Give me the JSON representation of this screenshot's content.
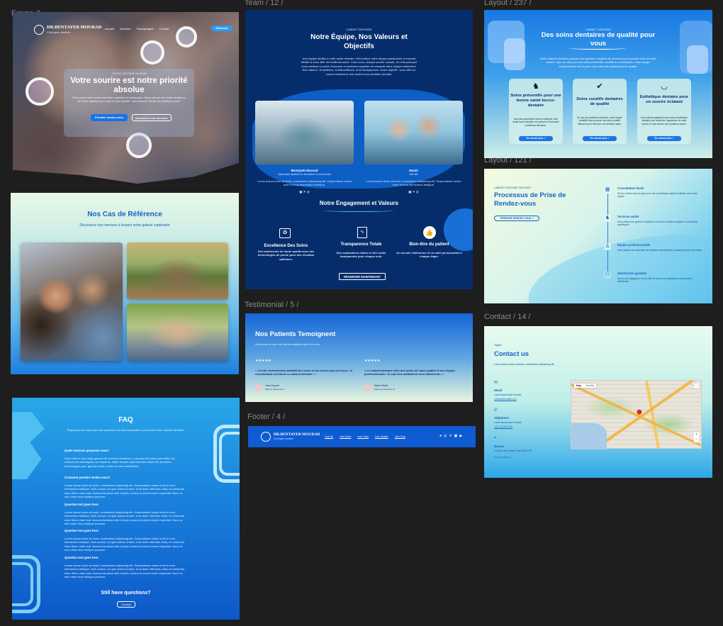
{
  "labels": {
    "frame": "Frame 2",
    "team": "Team / 12 /",
    "layout1": "Layout / 237 /",
    "layout2": "Layout / 121 /",
    "testimonial": "Testimonial / 5 /",
    "footer": "Footer / 4 /",
    "contact": "Contact / 14 /"
  },
  "colors": {
    "canvas": "#1e1e1e",
    "navy": "#0b2d6b",
    "primary": "#1565d8",
    "accent": "#2a9df4",
    "mint": "#e8fbf2"
  },
  "hero": {
    "logo": "DR.BENTAYEB MOURAD",
    "logo_sub": "Chirurgien dentiste",
    "nav": [
      "Accueil",
      "Services",
      "Témoignages",
      "Contact"
    ],
    "nav_btn": "Réserver",
    "kicker": "CENTRE DENTAIRE MOURAD",
    "title": "Votre sourire est notre priorité absolue",
    "text": "Découvrez notre centre dentaire moderne et chaleureux. Nous offrons des soins dentaires de haute qualité pour vous et votre famille. Votre sourire mérite les meilleurs soins.",
    "btn1": "Prendre rendez-vous",
    "btn2": "Découvrez nos services"
  },
  "team": {
    "kicker": "CABINET DENTAIRE",
    "title": "Notre Équipe, Nos Valeurs et Objectifs",
    "intro": "Une équipe dédiée à votre santé dentaire. Rencontrez notre équipe passionnée et experte dédiée à vous offrir les meilleurs soins. Chez nous, chaque sourire compte, et c'est pourquoi nous mettons un point d'honneur à combiner expertise et humanité dans chaque traitement. Nos valeurs : Excellence, la bienveillance, et la transparence. Notre objectif : vous offrir un sourire éclatant et une santé bucco-dentaire durable.",
    "member1_name": "Bentayeb Mourad",
    "member1_role": "Spécialiste diplômé en dentisterie et orthodontie",
    "member1_text": "Lorem ipsum dolor sit amet, consectetur adipiscing elit. Suspendisse varius enim in eros elementum tristique.",
    "member2_name": "Nomé",
    "member2_role": "Job title",
    "member2_text": "Lorem ipsum dolor sit amet, consectetur adipiscing elit. Suspendisse varius enim in eros elementum tristique.",
    "engage_title": "Notre Engagement et Valeurs",
    "val1_title": "Excellence Des Soins",
    "val1_text": "Des traitements de haute qualité avec des technologies de pointe pour des résultats optimaux.",
    "val2_title": "Transparence Totale",
    "val2_text": "Des explications claires et des coûts transparents pour chaque soin.",
    "val3_title": "Bien-être du patient",
    "val3_text": "Un accueil chaleureux et un suivi personnalisé à chaque étape.",
    "cta": "RÉSERVER MAINTENANT"
  },
  "services": {
    "kicker": "CABINET DENTAIRE",
    "title": "Des soins dentaires de qualité pour vous",
    "intro": "Notre cabinet dentaire propose une gamme complète de services pour prendre soin de votre sourire. Que ce soit pour des soins préventifs, curatifs ou esthétiques, notre équipe expérimentée est là pour vous offrir des traitements de qualité.",
    "cards": [
      {
        "title": "Soins préventifs pour une bonne santé bucco-dentaire",
        "text": "Nos soins préventifs visent à maintenir votre santé bucco-dentaire et à prévenir d'éventuels problèmes dentaires.",
        "btn": "En savoir plus  >",
        "icon": "tooth-icon"
      },
      {
        "title": "Soins curatifs dentaires de qualité",
        "text": "En cas de problèmes dentaires, notre équipe qualifiée vous propose des soins curatifs efficaces pour retrouver une dentition saine.",
        "btn": "En savoir plus  >",
        "icon": "check-icon"
      },
      {
        "title": "Esthétique dentaire pour un sourire éclatant",
        "text": "Nous offrons également des soins d'esthétique dentaire pour améliorer l'apparence de votre sourire et vous donner une confiance accrue.",
        "btn": "En savoir plus  >",
        "icon": "smile-icon"
      }
    ]
  },
  "process": {
    "kicker": "CABINET DENTAIRE DENTAIRE",
    "title": "Processus de Prise de Rendez-vous",
    "btn": "PRENDRE RENDEZ-VOUS  >",
    "steps": [
      {
        "title": "Consultation facile",
        "text": "Prenez rendez-vous en ligne pour une consultation rapide et efficace avec notre équipe."
      },
      {
        "title": "Services variés",
        "text": "Nous offrons une gamme complète de services dentaires adaptés à vos besoins spécifiques."
      },
      {
        "title": "Équipe professionnelle",
        "text": "Notre équipe est composée de dentistes expérimentés et passionnés par leur métier."
      },
      {
        "title": "Satisfaction garantie",
        "text": "Nous nous engageons à vous offrir un service de qualité pour votre entière satisfaction."
      }
    ]
  },
  "cases": {
    "title": "Nos Cas de Référence",
    "subtitle": "Découvrez nos services à travers notre galerie captivante"
  },
  "testimonial": {
    "title": "Nos Patients Temoignent",
    "subtitle": "Découvrez ce que nos clients satisfaits disent de nous.",
    "stars": "★★★★★",
    "q1": "« J'ai été extrêmement satisfait des soins et du service que j'ai reçus. Je recommande vivement ce cabinet dentaire. »",
    "n1": "Jean Dupont",
    "r1": "Patient, Entreprise A",
    "q2": "« Le cabinet dentaire offre des soins de haute qualité et une équipe professionnelle. Je suis très satisfait de mes traitements. »",
    "n2": "Marie Martin",
    "r2": "Patiente, Entreprise B"
  },
  "faq": {
    "title": "FAQ",
    "subtitle": "Réponses aux réponses aux questions les plus fréquentes concernant notre cabinet dentaire.",
    "items": [
      {
        "q": "Quels services proposez-vous?",
        "a": "Nous offrons une large gamme de services dentaires, y compris les soins préventifs, les traitements esthétiques, les implants. Notre équipe expérimentée utilise les dernières technologies pour garantir votre confort et votre satisfaction."
      },
      {
        "q": "Comment prendre rendez-vous?",
        "a": "Lorem ipsum dolor sit amet, consectetur adipiscing elit. Suspendisse varius enim in eros elementum tristique. Duis cursus, mi quis viverra ornare, eros dolor interdum nulla, ut commodo diam libero vitae erat. Aenean faucibus nibh et justo cursus id rutrum lorem imperdiet. Nunc ut sem vitae risus tristique posuere."
      },
      {
        "q": "Question text goes here",
        "a": "Lorem ipsum dolor sit amet, consectetur adipiscing elit. Suspendisse varius enim in eros elementum tristique. Duis cursus, mi quis viverra ornare, eros dolor interdum nulla, ut commodo diam libero vitae erat. Aenean faucibus nibh et justo cursus id rutrum lorem imperdiet. Nunc ut sem vitae risus tristique posuere."
      },
      {
        "q": "Question text goes here",
        "a": "Lorem ipsum dolor sit amet, consectetur adipiscing elit. Suspendisse varius enim in eros elementum tristique. Duis cursus, mi quis viverra ornare, eros dolor interdum nulla, ut commodo diam libero vitae erat. Aenean faucibus nibh et justo cursus id rutrum lorem imperdiet. Nunc ut sem vitae risus tristique posuere."
      },
      {
        "q": "Question text goes here",
        "a": "Lorem ipsum dolor sit amet, consectetur adipiscing elit. Suspendisse varius enim in eros elementum tristique. Duis cursus, mi quis viverra ornare, eros dolor interdum nulla, ut commodo diam libero vitae erat. Aenean faucibus nibh et justo cursus id rutrum lorem imperdiet. Nunc ut sem vitae risus tristique posuere."
      }
    ],
    "more_title": "Still have questions?",
    "more_btn": "Contact"
  },
  "footer": {
    "logo": "DR.BENTAYEB MOURAD",
    "logo_sub": "Chirurgien dentiste",
    "links": [
      "Link Un",
      "Lien Deux",
      "Lien Trois",
      "Lien Quatre",
      "Lien Cinq"
    ]
  },
  "contact": {
    "kicker": "Tagline",
    "title": "Contact us",
    "intro": "Lorem ipsum dolor sit amet, consectetur adipiscing elit.",
    "email_label": "Email",
    "email_text": "Lorem ipsum dolor sit amet",
    "email_value": "contact@monsite.com",
    "phone_label": "Téléphone",
    "phone_text": "Lorem ipsum dolor sit amet",
    "phone_value": "+33 1 23 45 67 89",
    "office_label": "Bureau",
    "office_text": "123 Rue de la Santé, Paris 75000 FR",
    "directions": "Get Directions  >",
    "map_tab1": "Map",
    "map_tab2": "Satellite"
  }
}
